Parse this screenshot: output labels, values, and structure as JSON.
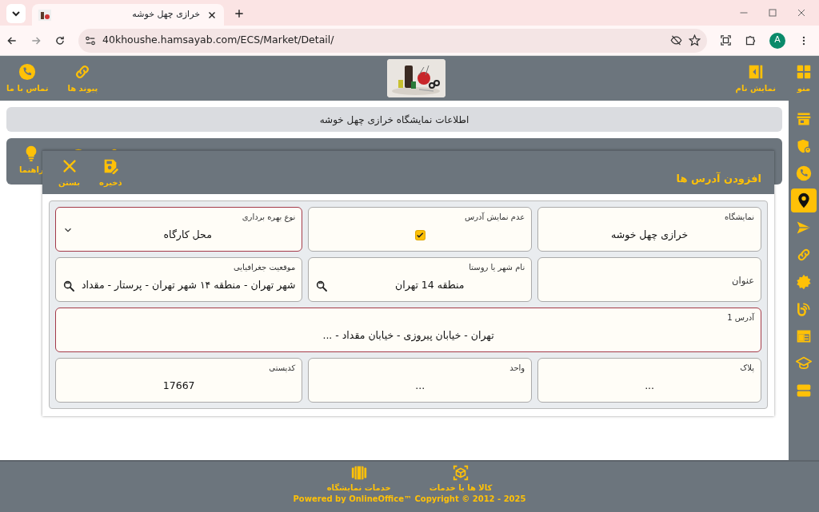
{
  "browser": {
    "tab_title": "خرازی چهل خوشه",
    "url": "40khoushe.hamsayab.com/ECS/Market/Detail/",
    "avatar": "A"
  },
  "header": {
    "start_buttons": [
      {
        "label": "منو",
        "kind": "grid"
      },
      {
        "label": "نمایش نام",
        "kind": "panel"
      }
    ],
    "end_buttons": [
      {
        "label": "پیوند ها",
        "kind": "link"
      },
      {
        "label": "تماس با ما",
        "kind": "phone"
      }
    ]
  },
  "info_bar": "اطلاعات نمایشگاه خرازی چهل خوشه",
  "background_toolbar": [
    {
      "label": "راهنما",
      "kind": "bulb"
    }
  ],
  "modal": {
    "title": "افزودن آدرس ها",
    "actions": [
      {
        "label": "ذخیره",
        "kind": "save"
      },
      {
        "label": "بستن",
        "kind": "close"
      }
    ],
    "fields": [
      {
        "kind": "text",
        "label": "نمایشگاه",
        "value": "خرازی چهل خوشه",
        "invalid": false,
        "wide": false
      },
      {
        "kind": "checkbox",
        "label": "عدم نمایش آدرس",
        "checked": true,
        "invalid": false,
        "wide": false
      },
      {
        "kind": "select",
        "label": "نوع بهره برداری",
        "value": "محل کارگاه",
        "invalid": true,
        "wide": false
      },
      {
        "kind": "label",
        "label": "عنوان",
        "invalid": false,
        "wide": false
      },
      {
        "kind": "lookup",
        "label": "نام شهر یا روستا",
        "value": "منطقه 14 تهران",
        "invalid": false,
        "wide": false
      },
      {
        "kind": "lookup",
        "label": "موقعیت جغرافیایی",
        "value": "شهر تهران - منطقه ۱۴ شهر تهران - پرستار - مقداد",
        "invalid": false,
        "wide": false
      },
      {
        "kind": "text",
        "label": "آدرس 1",
        "value": "تهران - خیابان پیروزی - خیابان مقداد - ...",
        "invalid": true,
        "wide": true
      },
      {
        "kind": "text",
        "label": "پلاک",
        "value": "...",
        "invalid": false,
        "wide": false
      },
      {
        "kind": "text",
        "label": "واحد",
        "value": "...",
        "invalid": false,
        "wide": false
      },
      {
        "kind": "text",
        "label": "کدپستی",
        "value": "17667",
        "invalid": false,
        "wide": false
      }
    ]
  },
  "sidebar": {
    "items": [
      {
        "kind": "store",
        "selected": false
      },
      {
        "kind": "shield",
        "selected": false
      },
      {
        "kind": "phone",
        "selected": false
      },
      {
        "kind": "pin",
        "selected": true
      },
      {
        "kind": "send",
        "selected": false
      },
      {
        "kind": "link",
        "selected": false
      },
      {
        "kind": "badge",
        "selected": false
      },
      {
        "kind": "feed",
        "selected": false
      },
      {
        "kind": "layout",
        "selected": false
      },
      {
        "kind": "cap",
        "selected": false
      },
      {
        "kind": "bars",
        "selected": false
      }
    ]
  },
  "footer": {
    "links": [
      {
        "label": "کالا ها یا خدمات",
        "kind": "cube"
      },
      {
        "label": "خدمات نمایشگاه",
        "kind": "carousel"
      }
    ],
    "copyright": "Powered by OnlineOffice™ Copyright © 2012 - 2025"
  }
}
